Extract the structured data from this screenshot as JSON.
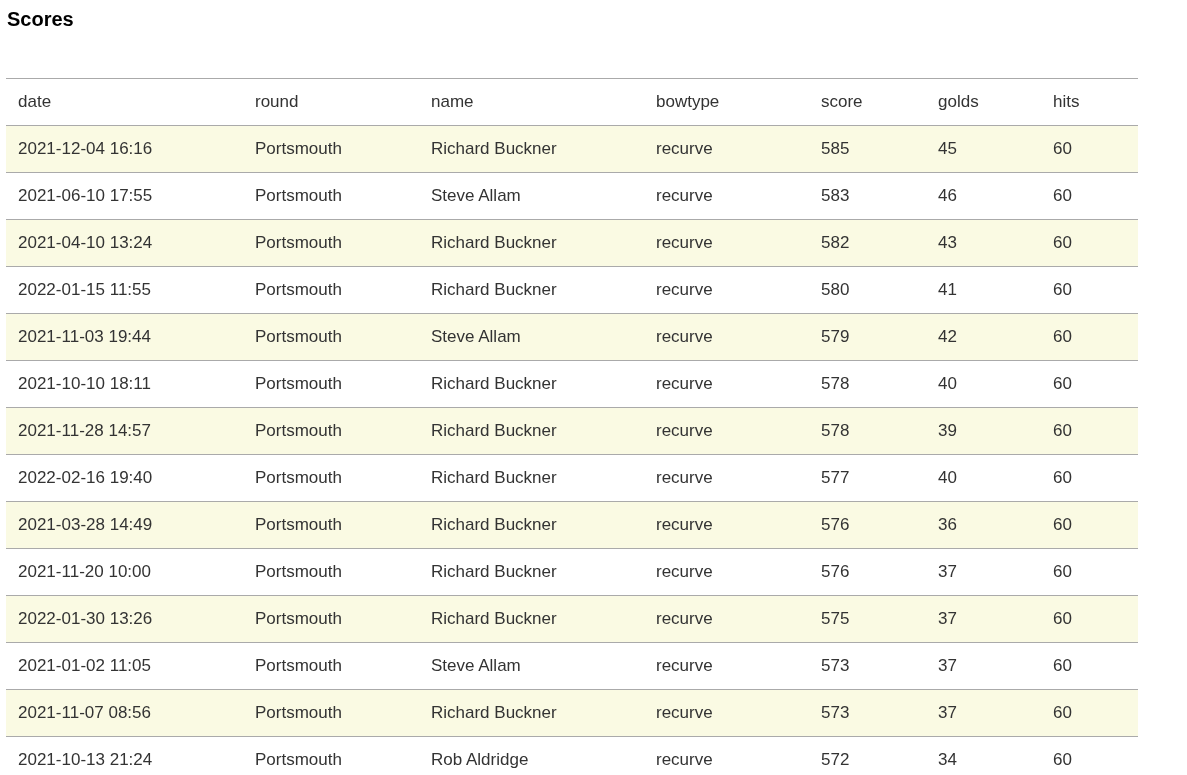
{
  "title": "Scores",
  "table": {
    "columns": [
      "date",
      "round",
      "name",
      "bowtype",
      "score",
      "golds",
      "hits"
    ],
    "rows": [
      [
        "2021-12-04 16:16",
        "Portsmouth",
        "Richard Buckner",
        "recurve",
        "585",
        "45",
        "60"
      ],
      [
        "2021-06-10 17:55",
        "Portsmouth",
        "Steve Allam",
        "recurve",
        "583",
        "46",
        "60"
      ],
      [
        "2021-04-10 13:24",
        "Portsmouth",
        "Richard Buckner",
        "recurve",
        "582",
        "43",
        "60"
      ],
      [
        "2022-01-15 11:55",
        "Portsmouth",
        "Richard Buckner",
        "recurve",
        "580",
        "41",
        "60"
      ],
      [
        "2021-11-03 19:44",
        "Portsmouth",
        "Steve Allam",
        "recurve",
        "579",
        "42",
        "60"
      ],
      [
        "2021-10-10 18:11",
        "Portsmouth",
        "Richard Buckner",
        "recurve",
        "578",
        "40",
        "60"
      ],
      [
        "2021-11-28 14:57",
        "Portsmouth",
        "Richard Buckner",
        "recurve",
        "578",
        "39",
        "60"
      ],
      [
        "2022-02-16 19:40",
        "Portsmouth",
        "Richard Buckner",
        "recurve",
        "577",
        "40",
        "60"
      ],
      [
        "2021-03-28 14:49",
        "Portsmouth",
        "Richard Buckner",
        "recurve",
        "576",
        "36",
        "60"
      ],
      [
        "2021-11-20 10:00",
        "Portsmouth",
        "Richard Buckner",
        "recurve",
        "576",
        "37",
        "60"
      ],
      [
        "2022-01-30 13:26",
        "Portsmouth",
        "Richard Buckner",
        "recurve",
        "575",
        "37",
        "60"
      ],
      [
        "2021-01-02 11:05",
        "Portsmouth",
        "Steve Allam",
        "recurve",
        "573",
        "37",
        "60"
      ],
      [
        "2021-11-07 08:56",
        "Portsmouth",
        "Richard Buckner",
        "recurve",
        "573",
        "37",
        "60"
      ],
      [
        "2021-10-13 21:24",
        "Portsmouth",
        "Rob Aldridge",
        "recurve",
        "572",
        "34",
        "60"
      ]
    ]
  }
}
